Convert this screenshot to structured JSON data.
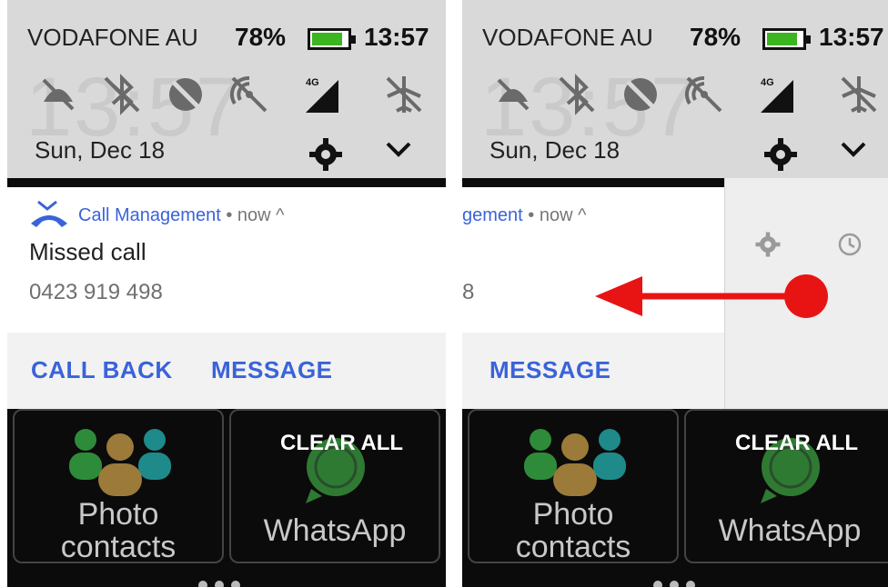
{
  "status_bar": {
    "carrier": "VODAFONE AU",
    "battery_percent": "78%",
    "battery_level": 0.78,
    "time": "13:57",
    "ghost_clock": "13:57"
  },
  "quick_settings": {
    "icons": [
      "do-not-disturb-off-icon",
      "bluetooth-off-icon",
      "data-saver-icon",
      "hotspot-off-icon",
      "signal-4g-icon",
      "airplane-off-icon"
    ],
    "network_badge": "4G",
    "date": "Sun, Dec 18"
  },
  "notification": {
    "app_name": "Call Management",
    "separator": "•",
    "time": "now",
    "app_name_cut": "gement",
    "title": "Missed call",
    "number": "0423 919 498",
    "number_cut": "8",
    "actions": {
      "call_back": "CALL BACK",
      "message": "MESSAGE"
    }
  },
  "launcher": {
    "tile_photo_contacts_line1": "Photo",
    "tile_photo_contacts_line2": "contacts",
    "tile_whatsapp": "WhatsApp",
    "clear_all": "CLEAR ALL"
  },
  "colors": {
    "accent": "#3a63d9",
    "arrow": "#e81414",
    "battery": "#3cb520"
  }
}
